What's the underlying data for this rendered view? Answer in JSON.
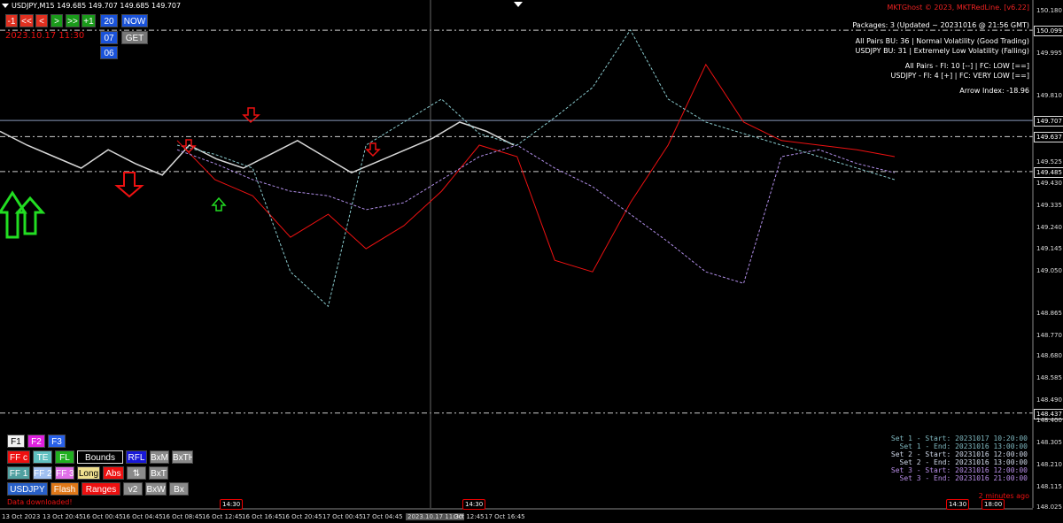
{
  "header": {
    "symbol_line": "USDJPY,M15  149.685 149.707 149.685 149.707",
    "copyright": "MKTGhost © 2023, MKTRedLine. [v6.22]"
  },
  "nav_buttons": [
    {
      "label": "-1",
      "bg": "#e03020"
    },
    {
      "label": "<<",
      "bg": "#e03020"
    },
    {
      "label": "<",
      "bg": "#e03020"
    },
    {
      "label": ">",
      "bg": "#1a9a1a"
    },
    {
      "label": ">>",
      "bg": "#1a9a1a"
    },
    {
      "label": "+1",
      "bg": "#1a9a1a"
    },
    {
      "label": "20",
      "bg": "#1a52d8"
    },
    {
      "label": "NOW",
      "bg": "#1a52d8"
    },
    {
      "label": "07",
      "bg": "#1a52d8"
    },
    {
      "label": "GET",
      "bg": "#777777"
    },
    {
      "label": "06",
      "bg": "#1a52d8"
    }
  ],
  "datetime_label": "2023.10.17 11:30",
  "info": {
    "packages": "Packages: 3 (Updated ~ 20231016 @ 21:56 GMT)",
    "all_pairs_bu": "All Pairs BU: 36 | Normal Volatility (Good Trading)",
    "usdjpy_bu": "USDJPY BU: 31 | Extremely Low Volatility (Falling)",
    "all_pairs_fi": "All Pairs - FI: 10 [--] | FC: LOW [==]",
    "usdjpy_fi": "USDJPY - FI: 4 [+] | FC: VERY LOW [==]",
    "arrow_index": "Arrow Index: -18.96"
  },
  "sets": [
    {
      "text": "Set 1 - Start: 20231017 10:20:00",
      "color": "#7fb8c0"
    },
    {
      "text": "Set 1 - End: 20231016 13:00:00",
      "color": "#7fb8c0"
    },
    {
      "text": "Set 2 - Start: 20231016 12:00:00",
      "color": "#cfd8e8"
    },
    {
      "text": "Set 2 - End: 20231016 13:00:00",
      "color": "#cfd8e8"
    },
    {
      "text": "Set 3 - Start: 20231016 12:00:00",
      "color": "#b88ee8"
    },
    {
      "text": "Set 3 - End: 20231016 21:00:00",
      "color": "#b88ee8"
    }
  ],
  "minutes_ago": "2 minutes ago",
  "data_downloaded": "Data downloaded!",
  "panel_buttons": [
    [
      {
        "label": "F1",
        "bg": "#f0f0f0",
        "fg": "#000"
      },
      {
        "label": "F2",
        "bg": "#e020e0",
        "fg": "#fff"
      },
      {
        "label": "F3",
        "bg": "#2860e8",
        "fg": "#fff"
      }
    ],
    [
      {
        "label": "FF c",
        "bg": "#ee1010",
        "fg": "#fff"
      },
      {
        "label": "TE",
        "bg": "#60c0c0",
        "fg": "#fff"
      },
      {
        "label": "FL",
        "bg": "#20b020",
        "fg": "#fff"
      },
      {
        "label": "Bounds",
        "bg": "#000000",
        "fg": "#fff"
      },
      {
        "label": "RFL",
        "bg": "#1818d8",
        "fg": "#fff"
      },
      {
        "label": "BxM",
        "bg": "#8a8a8a",
        "fg": "#fff"
      },
      {
        "label": "BxTH",
        "bg": "#8a8a8a",
        "fg": "#fff"
      }
    ],
    [
      {
        "label": "FF 1",
        "bg": "#50a0a0",
        "fg": "#fff"
      },
      {
        "label": "FF 2",
        "bg": "#a0c0f0",
        "fg": "#fff"
      },
      {
        "label": "FF 3",
        "bg": "#e070e8",
        "fg": "#fff"
      },
      {
        "label": "Long",
        "bg": "#f0e090",
        "fg": "#000"
      },
      {
        "label": "Abs",
        "bg": "#ee1010",
        "fg": "#fff"
      },
      {
        "label": "⇅",
        "bg": "#8a8a8a",
        "fg": "#fff"
      },
      {
        "label": "BxT",
        "bg": "#8a8a8a",
        "fg": "#fff"
      }
    ],
    [
      {
        "label": "USDJPY",
        "bg": "#2860c8",
        "fg": "#fff"
      },
      {
        "label": "Flash",
        "bg": "#e07818",
        "fg": "#fff"
      },
      {
        "label": "Ranges",
        "bg": "#ee1010",
        "fg": "#fff"
      },
      {
        "label": "v2",
        "bg": "#8a8a8a",
        "fg": "#fff"
      },
      {
        "label": "BxW",
        "bg": "#8a8a8a",
        "fg": "#fff"
      },
      {
        "label": "Bx",
        "bg": "#8a8a8a",
        "fg": "#fff"
      }
    ]
  ],
  "price_axis": {
    "ticks": [
      "150.180",
      "150.099",
      "149.995",
      "149.810",
      "149.707",
      "149.637",
      "149.525",
      "149.485",
      "149.430",
      "149.335",
      "149.240",
      "149.145",
      "149.050",
      "148.865",
      "148.770",
      "148.680",
      "148.585",
      "148.490",
      "148.437",
      "148.400",
      "148.305",
      "148.210",
      "148.115",
      "148.025"
    ],
    "marked": [
      "150.099",
      "149.707",
      "149.637",
      "149.485",
      "148.437"
    ]
  },
  "time_axis": {
    "labels": [
      "13 Oct 2023",
      "13 Oct 20:45",
      "16 Oct 00:45",
      "16 Oct 04:45",
      "16 Oct 08:45",
      "16 Oct 12:45",
      "16 Oct 16:45",
      "16 Oct 20:45",
      "17 Oct 00:45",
      "17 Oct 04:45",
      "2023.10.17 11:30",
      "Oct 12:45",
      "17 Oct 16:45"
    ],
    "markers": [
      "14:30",
      "14:30",
      "14:30",
      "18:00"
    ]
  },
  "chart_data": {
    "type": "line",
    "symbol": "USDJPY",
    "timeframe": "M15",
    "ylim": [
      148.025,
      150.23
    ],
    "ohlc_last": {
      "open": 149.685,
      "high": 149.707,
      "low": 149.685,
      "close": 149.707
    },
    "hlines": [
      150.099,
      149.707,
      149.637,
      149.485,
      148.437
    ],
    "crosshair_time": "2023.10.17 11:30",
    "grid": false,
    "legend": "none",
    "series": [
      {
        "color": "#d8d8d8",
        "values": [
          149.66,
          149.6,
          149.55,
          149.5,
          149.58,
          149.52,
          149.47,
          149.6,
          149.54,
          149.5,
          149.56,
          149.62,
          149.55,
          149.48,
          149.53,
          149.58,
          149.63,
          149.7,
          149.66,
          149.6
        ]
      },
      {
        "color": "#ee1111",
        "values": [
          149.62,
          149.45,
          149.38,
          149.2,
          149.3,
          149.15,
          149.25,
          149.4,
          149.6,
          149.55,
          149.1,
          149.05,
          149.35,
          149.6,
          149.95,
          149.7,
          149.62,
          149.6,
          149.58,
          149.55
        ]
      },
      {
        "color": "#b08ee8",
        "values": [
          149.58,
          149.52,
          149.45,
          149.4,
          149.38,
          149.32,
          149.35,
          149.45,
          149.55,
          149.6,
          149.5,
          149.42,
          149.3,
          149.18,
          149.05,
          149.0,
          149.55,
          149.58,
          149.52,
          149.48
        ]
      },
      {
        "color": "#88c8cc",
        "values": [
          149.6,
          149.56,
          149.5,
          149.05,
          148.9,
          149.6,
          149.7,
          149.8,
          149.65,
          149.6,
          149.72,
          149.85,
          150.1,
          149.8,
          149.7,
          149.65,
          149.6,
          149.55,
          149.5,
          149.45
        ]
      }
    ]
  }
}
